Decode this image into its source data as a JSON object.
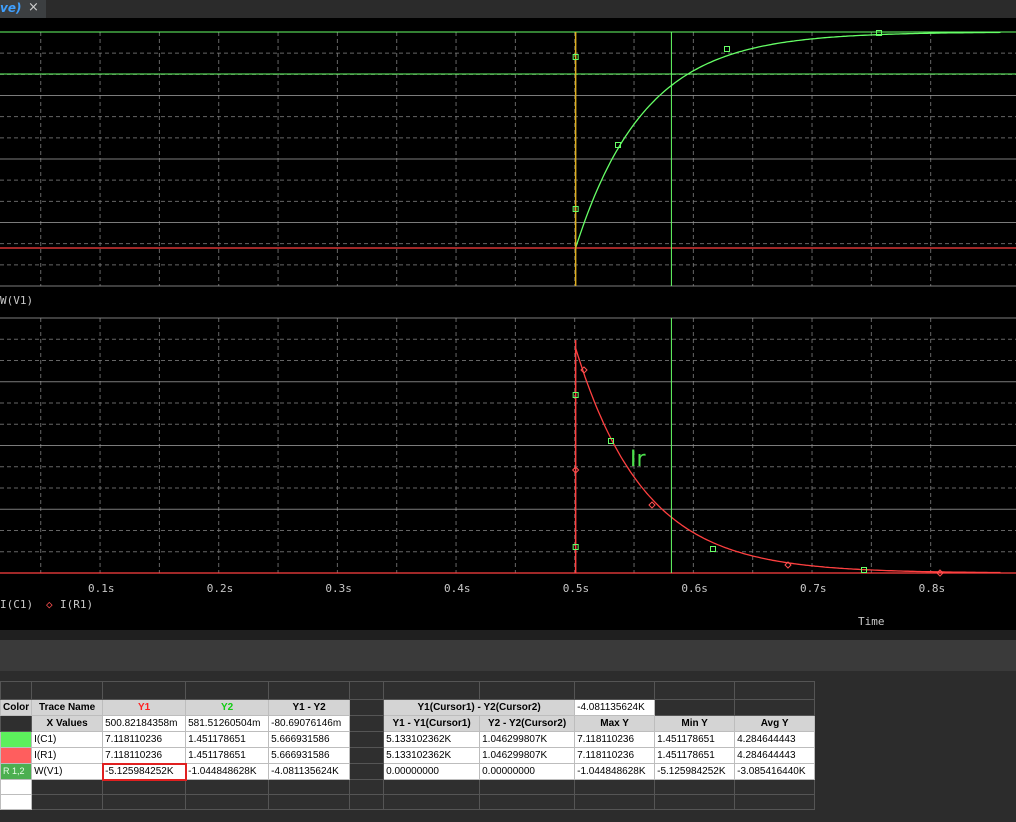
{
  "tab": {
    "title": "ve)",
    "close_glyph": "×"
  },
  "plot": {
    "upper_trace_label": "W(V1)",
    "lower_legend": [
      "I(C1)",
      "I(R1)"
    ],
    "trace_annotation": "Ir",
    "x_tick_labels": [
      "0.1s",
      "0.2s",
      "0.3s",
      "0.4s",
      "0.5s",
      "0.6s",
      "0.7s",
      "0.8s"
    ],
    "x_axis_label": "Time",
    "colors": {
      "green": "#66ff66",
      "red": "#ff4040",
      "cursor1": "#e0b020",
      "grid": "#808080"
    }
  },
  "table": {
    "header_row1": {
      "color": "Color",
      "trace_name": "Trace Name",
      "y1": "Y1",
      "y2": "Y2",
      "y1_y2": "Y1 - Y2",
      "c_label": "Y1(Cursor1) - Y2(Cursor2)",
      "c_value": "-4.081135624K"
    },
    "header_row2": {
      "x_values": "X Values",
      "x1": "500.82184358m",
      "x2": "581.51260504m",
      "x_diff": "-80.69076146m",
      "d1": "Y1 - Y1(Cursor1)",
      "d2": "Y2 - Y2(Cursor2)",
      "max": "Max Y",
      "min": "Min Y",
      "avg": "Avg Y"
    },
    "rows": [
      {
        "color_label": "",
        "name": "I(C1)",
        "y1": "7.118110236",
        "y2": "1.451178651",
        "diff": "5.666931586",
        "d1": "5.133102362K",
        "d2": "1.046299807K",
        "max": "7.118110236",
        "min": "1.451178651",
        "avg": "4.284644443"
      },
      {
        "color_label": "",
        "name": "I(R1)",
        "y1": "7.118110236",
        "y2": "1.451178651",
        "diff": "5.666931586",
        "d1": "5.133102362K",
        "d2": "1.046299807K",
        "max": "7.118110236",
        "min": "1.451178651",
        "avg": "4.284644443"
      },
      {
        "color_label": "R 1,2",
        "name": "W(V1)",
        "y1": "-5.125984252K",
        "y2": "-1.044848628K",
        "diff": "-4.081135624K",
        "d1": "0.00000000",
        "d2": "0.00000000",
        "max": "-1.044848628K",
        "min": "-5.125984252K",
        "avg": "-3.085416440K"
      }
    ]
  }
}
